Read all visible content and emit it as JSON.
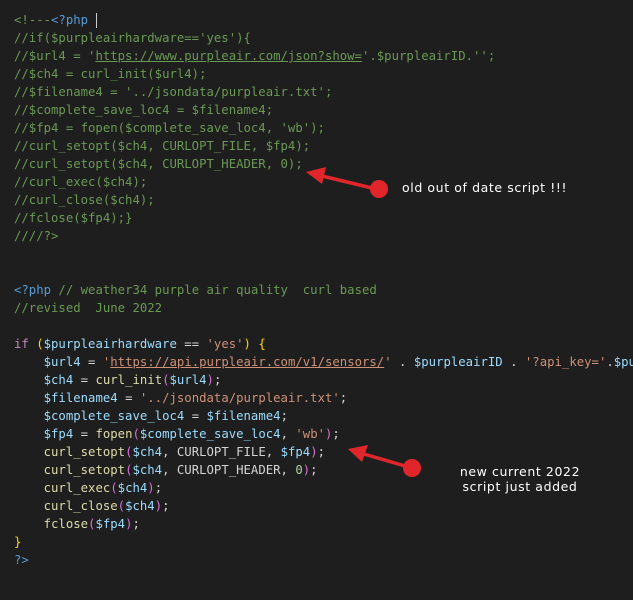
{
  "lines": [
    [
      {
        "t": "<!---",
        "c": "cmt"
      },
      {
        "t": "<?php",
        "c": "kw"
      },
      {
        "t": " ",
        "c": "plain"
      }
    ],
    [
      {
        "t": "//if($purpleairhardware=='yes'){",
        "c": "cmt"
      }
    ],
    [
      {
        "t": "//$url4 = '",
        "c": "cmt"
      },
      {
        "t": "https://www.purpleair.com/json?show=",
        "c": "cmt-u"
      },
      {
        "t": "'.$purpleairID.'';",
        "c": "cmt"
      }
    ],
    [
      {
        "t": "//$ch4 = curl_init($url4);",
        "c": "cmt"
      }
    ],
    [
      {
        "t": "//$filename4 = '../jsondata/purpleair.txt';",
        "c": "cmt"
      }
    ],
    [
      {
        "t": "//$complete_save_loc4 = $filename4;",
        "c": "cmt"
      }
    ],
    [
      {
        "t": "//$fp4 = fopen($complete_save_loc4, 'wb');",
        "c": "cmt"
      }
    ],
    [
      {
        "t": "//curl_setopt($ch4, CURLOPT_FILE, $fp4);",
        "c": "cmt"
      }
    ],
    [
      {
        "t": "//curl_setopt($ch4, CURLOPT_HEADER, 0);",
        "c": "cmt"
      }
    ],
    [
      {
        "t": "//curl_exec($ch4);",
        "c": "cmt"
      }
    ],
    [
      {
        "t": "//curl_close($ch4);",
        "c": "cmt"
      }
    ],
    [
      {
        "t": "//fclose($fp4);}",
        "c": "cmt"
      }
    ],
    [
      {
        "t": "////?>",
        "c": "cmt"
      }
    ],
    [],
    [],
    [
      {
        "t": "<?php",
        "c": "kw"
      },
      {
        "t": " // weather34 purple air quality  curl based",
        "c": "cmt"
      }
    ],
    [
      {
        "t": "//revised  June 2022",
        "c": "cmt"
      }
    ],
    [],
    [
      {
        "t": "if",
        "c": "ctl"
      },
      {
        "t": " ",
        "c": "plain"
      },
      {
        "t": "(",
        "c": "br1"
      },
      {
        "t": "$purpleairhardware",
        "c": "var"
      },
      {
        "t": " == ",
        "c": "plain"
      },
      {
        "t": "'yes'",
        "c": "str"
      },
      {
        "t": ")",
        "c": "br1"
      },
      {
        "t": " ",
        "c": "plain"
      },
      {
        "t": "{",
        "c": "br1"
      }
    ],
    [
      {
        "t": "    ",
        "c": "plain"
      },
      {
        "t": "$url4",
        "c": "var"
      },
      {
        "t": " = ",
        "c": "plain"
      },
      {
        "t": "'",
        "c": "str"
      },
      {
        "t": "https://api.purpleair.com/v1/sensors/",
        "c": "str-u"
      },
      {
        "t": "'",
        "c": "str"
      },
      {
        "t": " . ",
        "c": "plain"
      },
      {
        "t": "$purpleairID",
        "c": "var"
      },
      {
        "t": " . ",
        "c": "plain"
      },
      {
        "t": "'?api_key='",
        "c": "str"
      },
      {
        "t": ".",
        "c": "plain"
      },
      {
        "t": "$purp",
        "c": "var"
      }
    ],
    [
      {
        "t": "    ",
        "c": "plain"
      },
      {
        "t": "$ch4",
        "c": "var"
      },
      {
        "t": " = ",
        "c": "plain"
      },
      {
        "t": "curl_init",
        "c": "fn"
      },
      {
        "t": "(",
        "c": "br2"
      },
      {
        "t": "$url4",
        "c": "var"
      },
      {
        "t": ")",
        "c": "br2"
      },
      {
        "t": ";",
        "c": "plain"
      }
    ],
    [
      {
        "t": "    ",
        "c": "plain"
      },
      {
        "t": "$filename4",
        "c": "var"
      },
      {
        "t": " = ",
        "c": "plain"
      },
      {
        "t": "'../jsondata/purpleair.txt'",
        "c": "str"
      },
      {
        "t": ";",
        "c": "plain"
      }
    ],
    [
      {
        "t": "    ",
        "c": "plain"
      },
      {
        "t": "$complete_save_loc4",
        "c": "var"
      },
      {
        "t": " = ",
        "c": "plain"
      },
      {
        "t": "$filename4",
        "c": "var"
      },
      {
        "t": ";",
        "c": "plain"
      }
    ],
    [
      {
        "t": "    ",
        "c": "plain"
      },
      {
        "t": "$fp4",
        "c": "var"
      },
      {
        "t": " = ",
        "c": "plain"
      },
      {
        "t": "fopen",
        "c": "fn"
      },
      {
        "t": "(",
        "c": "br2"
      },
      {
        "t": "$complete_save_loc4",
        "c": "var"
      },
      {
        "t": ", ",
        "c": "plain"
      },
      {
        "t": "'wb'",
        "c": "str"
      },
      {
        "t": ")",
        "c": "br2"
      },
      {
        "t": ";",
        "c": "plain"
      }
    ],
    [
      {
        "t": "    ",
        "c": "plain"
      },
      {
        "t": "curl_setopt",
        "c": "fn"
      },
      {
        "t": "(",
        "c": "br2"
      },
      {
        "t": "$ch4",
        "c": "var"
      },
      {
        "t": ", CURLOPT_FILE, ",
        "c": "plain"
      },
      {
        "t": "$fp4",
        "c": "var"
      },
      {
        "t": ")",
        "c": "br2"
      },
      {
        "t": ";",
        "c": "plain"
      }
    ],
    [
      {
        "t": "    ",
        "c": "plain"
      },
      {
        "t": "curl_setopt",
        "c": "fn"
      },
      {
        "t": "(",
        "c": "br2"
      },
      {
        "t": "$ch4",
        "c": "var"
      },
      {
        "t": ", CURLOPT_HEADER, ",
        "c": "plain"
      },
      {
        "t": "0",
        "c": "num"
      },
      {
        "t": ")",
        "c": "br2"
      },
      {
        "t": ";",
        "c": "plain"
      }
    ],
    [
      {
        "t": "    ",
        "c": "plain"
      },
      {
        "t": "curl_exec",
        "c": "fn"
      },
      {
        "t": "(",
        "c": "br2"
      },
      {
        "t": "$ch4",
        "c": "var"
      },
      {
        "t": ")",
        "c": "br2"
      },
      {
        "t": ";",
        "c": "plain"
      }
    ],
    [
      {
        "t": "    ",
        "c": "plain"
      },
      {
        "t": "curl_close",
        "c": "fn"
      },
      {
        "t": "(",
        "c": "br2"
      },
      {
        "t": "$ch4",
        "c": "var"
      },
      {
        "t": ")",
        "c": "br2"
      },
      {
        "t": ";",
        "c": "plain"
      }
    ],
    [
      {
        "t": "    ",
        "c": "plain"
      },
      {
        "t": "fclose",
        "c": "fn"
      },
      {
        "t": "(",
        "c": "br2"
      },
      {
        "t": "$fp4",
        "c": "var"
      },
      {
        "t": ")",
        "c": "br2"
      },
      {
        "t": ";",
        "c": "plain"
      }
    ],
    [
      {
        "t": "}",
        "c": "br1"
      }
    ],
    [
      {
        "t": "?>",
        "c": "kw"
      }
    ]
  ],
  "annotations": {
    "old": "old out of date script  !!!",
    "new_line1": "new current 2022",
    "new_line2": "script just added"
  },
  "colors": {
    "background": "#1e1e1e",
    "comment": "#6a9955",
    "arrow": "#e0262b"
  }
}
